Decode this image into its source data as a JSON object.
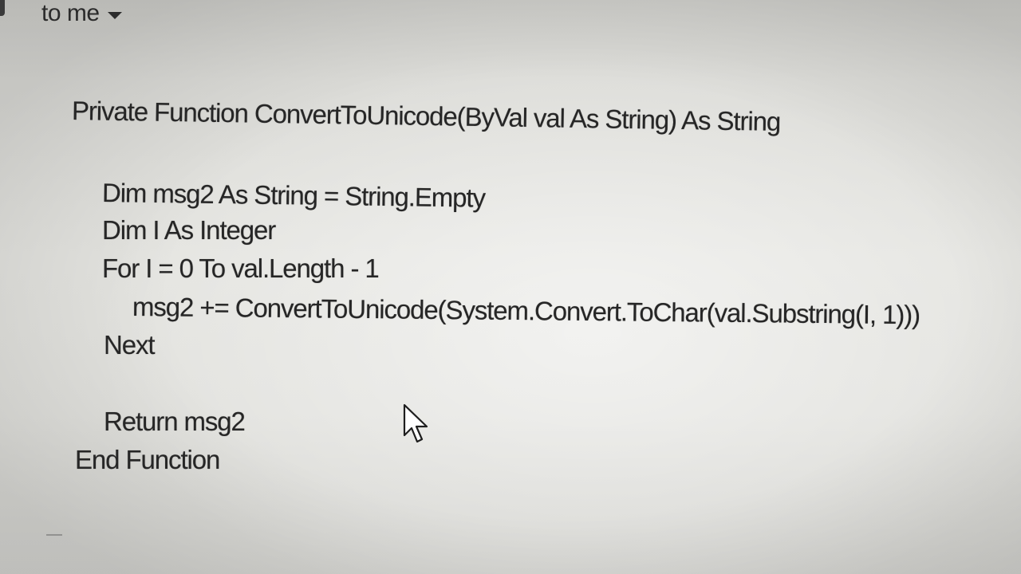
{
  "email": {
    "recipient_label": "to me"
  },
  "code": {
    "lines": [
      "Private Function ConvertToUnicode(ByVal val As String) As String",
      "Dim msg2 As String = String.Empty",
      "Dim I As Integer",
      "For I = 0 To val.Length - 1",
      "msg2 += ConvertToUnicode(System.Convert.ToChar(val.Substring(I, 1)))",
      "Next",
      "Return msg2",
      "End Function"
    ]
  },
  "signature": {
    "dash": "--"
  },
  "icons": {
    "recipient_dropdown": "chevron-down-icon",
    "pointer": "mouse-pointer-icon"
  },
  "colors": {
    "text": "#262626",
    "screen": "#e2e2de"
  }
}
